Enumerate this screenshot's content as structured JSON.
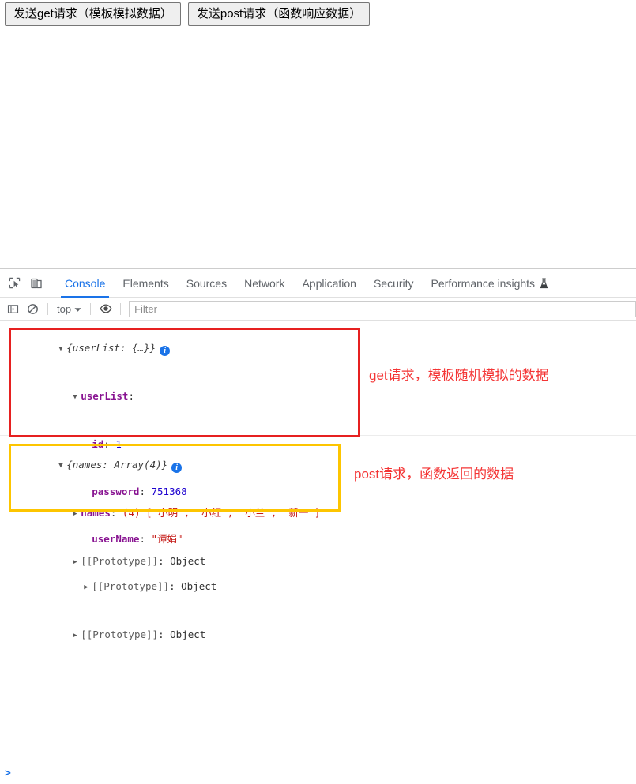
{
  "page": {
    "buttons": [
      {
        "label": "发送get请求（模板模拟数据）",
        "name": "send-get-request-button"
      },
      {
        "label": "发送post请求（函数响应数据）",
        "name": "send-post-request-button"
      }
    ]
  },
  "devtools": {
    "icons": {
      "inspect": "inspect-element-icon",
      "device": "device-toolbar-icon",
      "sidebar": "console-sidebar-icon",
      "clear": "clear-console-icon",
      "eye": "live-expression-eye-icon",
      "beaker": "experiment-beaker-icon",
      "chevron": "chevron-down-icon"
    },
    "tabs": [
      {
        "label": "Console",
        "active": true
      },
      {
        "label": "Elements",
        "active": false
      },
      {
        "label": "Sources",
        "active": false
      },
      {
        "label": "Network",
        "active": false
      },
      {
        "label": "Application",
        "active": false
      },
      {
        "label": "Security",
        "active": false
      },
      {
        "label": "Performance insights",
        "active": false,
        "beaker": true
      }
    ],
    "toolbar": {
      "context_label": "top",
      "filter_placeholder": "Filter",
      "filter_value": ""
    },
    "prompt": ">",
    "accent_color": "#1a73e8"
  },
  "console": {
    "messages": [
      {
        "name": "console-message-userlist",
        "preview": "{userList: {…}}",
        "info_icon": "i",
        "rows": [
          {
            "indent": 1,
            "tri": "open",
            "key": "userList",
            "sep": ":",
            "value": "",
            "value_type": "none"
          },
          {
            "indent": 2,
            "tri": "none",
            "key": "id",
            "sep": ":",
            "value": "1",
            "value_type": "number"
          },
          {
            "indent": 2,
            "tri": "none",
            "key": "password",
            "sep": ":",
            "value": "751368",
            "value_type": "number"
          },
          {
            "indent": 2,
            "tri": "none",
            "key": "userName",
            "sep": ":",
            "value": "\"谭娟\"",
            "value_type": "string"
          },
          {
            "indent": 2,
            "tri": "closed",
            "key": "[[Prototype]]",
            "sep": ":",
            "value": "Object",
            "value_type": "proto"
          },
          {
            "indent": 1,
            "tri": "closed",
            "key": "[[Prototype]]",
            "sep": ":",
            "value": "Object",
            "value_type": "proto"
          }
        ]
      },
      {
        "name": "console-message-names",
        "preview": "{names: Array(4)}",
        "info_icon": "i",
        "rows": [
          {
            "indent": 1,
            "tri": "closed",
            "key": "names",
            "sep": ":",
            "value": "(4) ['小明', '小红', '小兰', '新一']",
            "value_type": "array"
          },
          {
            "indent": 1,
            "tri": "closed",
            "key": "[[Prototype]]",
            "sep": ":",
            "value": "Object",
            "value_type": "proto"
          }
        ]
      }
    ],
    "colors": {
      "key": "#881391",
      "number": "#1c00cf",
      "string": "#c41a16",
      "proto": "#5d5d5d"
    }
  },
  "annotations": [
    {
      "name": "annotation-get-request",
      "text": "get请求，模板随机模拟的数据",
      "color": "#f43535",
      "box_color": "#e62020"
    },
    {
      "name": "annotation-post-request",
      "text": "post请求，函数返回的数据",
      "color": "#f43535",
      "box_color": "#fdc500"
    }
  ]
}
